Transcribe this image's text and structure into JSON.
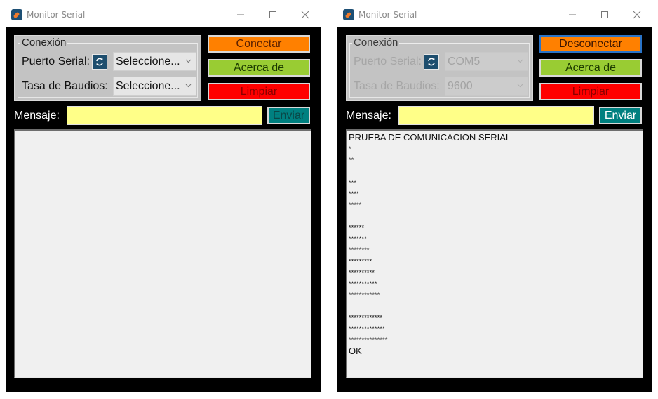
{
  "windows": [
    {
      "id": "disconnected",
      "title": "Monitor Serial",
      "window_controls": {
        "minimize": "minimize",
        "maximize": "maximize",
        "close": "close"
      },
      "connection_group": {
        "legend": "Conexión",
        "port_label": "Puerto Serial:",
        "port_value": "Seleccione...",
        "baud_label": "Tasa de Baudios:",
        "baud_value": "Seleccione...",
        "enabled": true
      },
      "buttons": {
        "connect": "Conectar",
        "about": "Acerca de",
        "clear": "Limpiar",
        "send": "Enviar"
      },
      "message": {
        "label": "Mensaje:",
        "value": ""
      },
      "output_lines": []
    },
    {
      "id": "connected",
      "title": "Monitor Serial",
      "window_controls": {
        "minimize": "minimize",
        "maximize": "maximize",
        "close": "close"
      },
      "connection_group": {
        "legend": "Conexión",
        "port_label": "Puerto Serial:",
        "port_value": "COM5",
        "baud_label": "Tasa de Baudios:",
        "baud_value": "9600",
        "enabled": false
      },
      "buttons": {
        "connect": "Desconectar",
        "about": "Acerca de",
        "clear": "Limpiar",
        "send": "Enviar"
      },
      "message": {
        "label": "Mensaje:",
        "value": ""
      },
      "output_lines": [
        "PRUEBA DE COMUNICACION SERIAL",
        "*",
        "**",
        "",
        "***",
        "****",
        "*****",
        "",
        "******",
        "*******",
        "********",
        "*********",
        "**********",
        "***********",
        "************",
        "",
        "*************",
        "**************",
        "***************",
        "OK"
      ]
    }
  ],
  "colors": {
    "connect_button": "#ff8000",
    "about_button": "#99cc33",
    "clear_button": "#ff0000",
    "send_button": "#008080",
    "message_input": "#ffff88",
    "background": "#000000",
    "group_box": "#c3c3c3"
  },
  "icons": {
    "app": "rocket-app-icon",
    "refresh": "refresh-icon",
    "dropdown": "chevron-down-icon"
  }
}
